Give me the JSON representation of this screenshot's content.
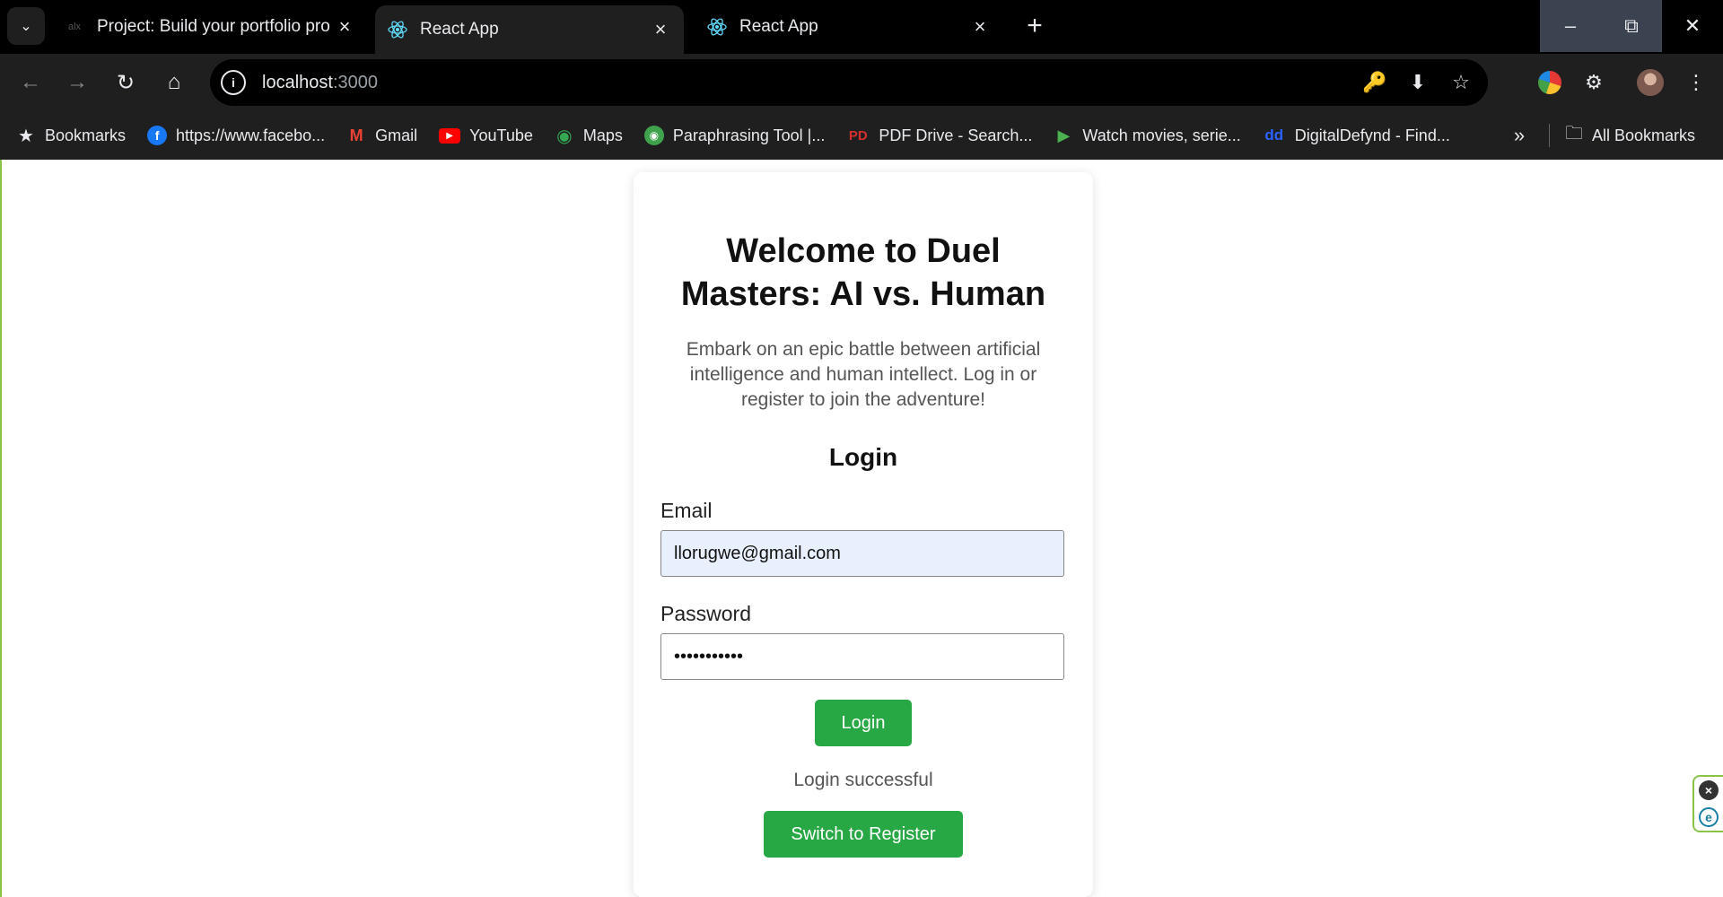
{
  "browser": {
    "tabs": [
      {
        "title": "Project: Build your portfolio pro",
        "favicon": "alx-icon",
        "active": false
      },
      {
        "title": "React App",
        "favicon": "react-icon",
        "active": true
      },
      {
        "title": "React App",
        "favicon": "react-icon",
        "active": false
      }
    ],
    "url_host": "localhost",
    "url_port": ":3000",
    "bookmarks": [
      {
        "label": "Bookmarks",
        "icon": "star-icon"
      },
      {
        "label": "https://www.facebo...",
        "icon": "facebook-icon"
      },
      {
        "label": "Gmail",
        "icon": "gmail-icon"
      },
      {
        "label": "YouTube",
        "icon": "youtube-icon"
      },
      {
        "label": "Maps",
        "icon": "maps-icon"
      },
      {
        "label": "Paraphrasing Tool |...",
        "icon": "paraphrase-icon"
      },
      {
        "label": "PDF Drive - Search...",
        "icon": "pdf-drive-icon"
      },
      {
        "label": "Watch movies, serie...",
        "icon": "play-icon"
      },
      {
        "label": "DigitalDefynd - Find...",
        "icon": "digitaldefynd-icon"
      }
    ],
    "all_bookmarks": "All Bookmarks"
  },
  "page": {
    "title": "Welcome to Duel Masters: AI vs. Human",
    "subtitle": "Embark on an epic battle between artificial intelligence and human intellect. Log in or register to join the adventure!",
    "form_heading": "Login",
    "email_label": "Email",
    "email_value": "llorugwe@gmail.com",
    "password_label": "Password",
    "password_value": "•••••••••••",
    "login_button": "Login",
    "status_message": "Login successful",
    "switch_button": "Switch to Register"
  },
  "colors": {
    "button_green": "#28a745",
    "autofill_blue": "#e8f0fe",
    "chrome_dark": "#1f1f1f"
  }
}
